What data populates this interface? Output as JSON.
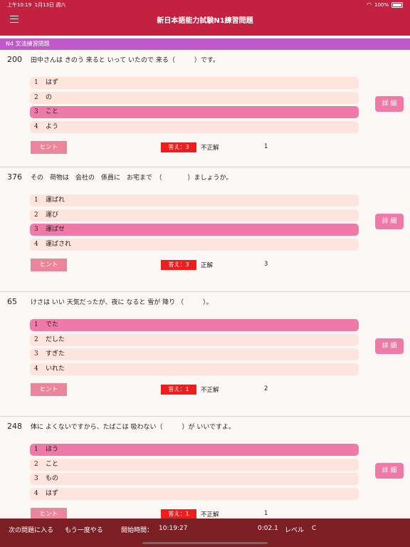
{
  "status": {
    "time": "上午10:19",
    "date": "1月13日 週六",
    "battery": "100%"
  },
  "header": {
    "title": "新日本語能力試験N1練習問題"
  },
  "section": {
    "label": "N4 文法練習問題"
  },
  "questions": [
    {
      "number": "200",
      "text": "田中さんは きのう 来ると いって いたので 来る（　　　）です。",
      "options": [
        {
          "n": "1",
          "label": "はず"
        },
        {
          "n": "2",
          "label": "の"
        },
        {
          "n": "3",
          "label": "こと"
        },
        {
          "n": "4",
          "label": "よう"
        }
      ],
      "selected": 2,
      "detail": "詳 細",
      "hint": "ヒント",
      "answer": "答え：3",
      "verdict": "不正解",
      "count": "1"
    },
    {
      "number": "376",
      "text": "その　荷物は　会社の　係員に　お宅まで　（　　　　）ましょうか。",
      "options": [
        {
          "n": "1",
          "label": "運ばれ"
        },
        {
          "n": "2",
          "label": "運び"
        },
        {
          "n": "3",
          "label": "運ばせ"
        },
        {
          "n": "4",
          "label": "運ばされ"
        }
      ],
      "selected": 2,
      "detail": "詳 細",
      "hint": "ヒント",
      "answer": "答え：3",
      "verdict": "正解",
      "count": "3"
    },
    {
      "number": "65",
      "text": "けさは いい 天気だったが、夜に なると 雪が 降り （　　　）。",
      "options": [
        {
          "n": "1",
          "label": "でた"
        },
        {
          "n": "2",
          "label": "だした"
        },
        {
          "n": "3",
          "label": "すぎた"
        },
        {
          "n": "4",
          "label": "いれた"
        }
      ],
      "selected": 0,
      "detail": "詳 細",
      "hint": "ヒント",
      "answer": "答え：1",
      "verdict": "不正解",
      "count": "2"
    },
    {
      "number": "248",
      "text": "体に よくないですから、たばこは 吸わない（　　　）が いいですよ。",
      "options": [
        {
          "n": "1",
          "label": "ほう"
        },
        {
          "n": "2",
          "label": "こと"
        },
        {
          "n": "3",
          "label": "もの"
        },
        {
          "n": "4",
          "label": "はず"
        }
      ],
      "selected": 0,
      "detail": "詳 細",
      "hint": "ヒント",
      "answer": "答え：1",
      "verdict": "不正解",
      "count": "1"
    }
  ],
  "footer": {
    "next": "次の問題に入る",
    "retry": "もう一度やる",
    "start_label": "開始時間：",
    "start_time": "10:19:27",
    "elapsed": "0:02.1",
    "level_label": "レベル",
    "level": "C"
  },
  "colors": {
    "header": "#c2213f",
    "section": "#bf59c8",
    "selected": "#ef7aa7",
    "footer": "#7b1f25"
  }
}
